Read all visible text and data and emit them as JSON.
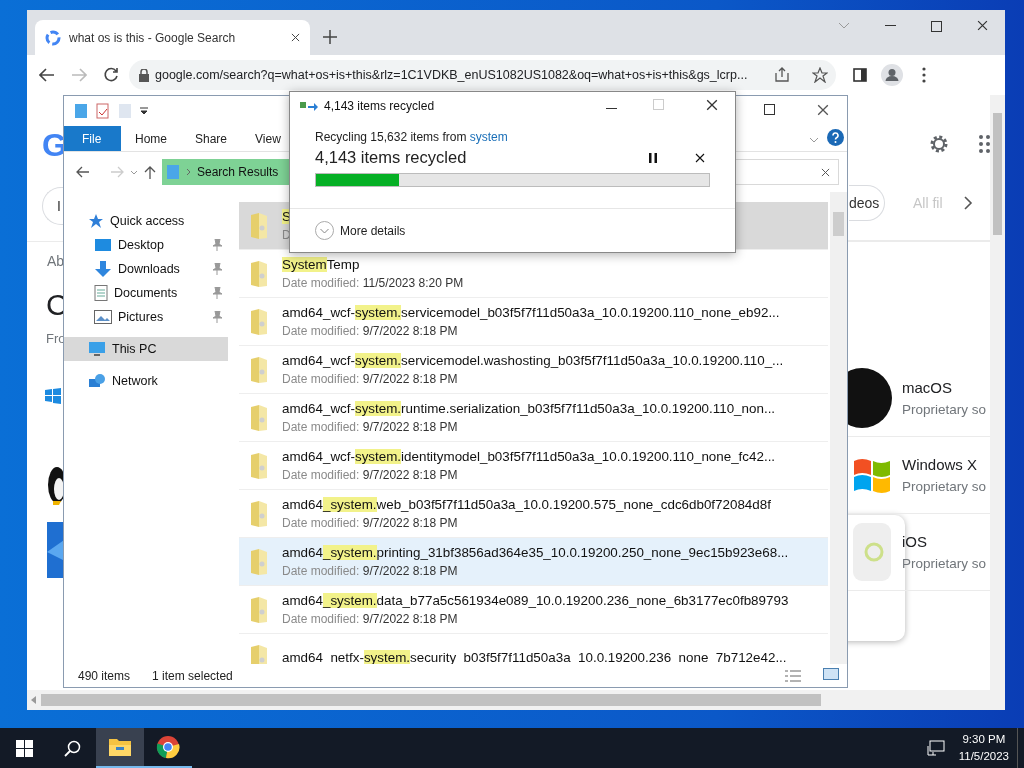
{
  "browser": {
    "tab": {
      "title": "what os is this - Google Search",
      "selected": true
    },
    "url": "google.com/search?q=what+os+is+this&rlz=1C1VDKB_enUS1082US1082&oq=what+os+is+this&gs_lcrp...",
    "page": {
      "logo_fragment": "G",
      "left_chip": "I",
      "about_fragment": "Ab",
      "heading_fragment": "C",
      "source_fragment": "Fro",
      "chips": [
        {
          "label": "deos",
          "faded": false
        },
        {
          "label": "All fil",
          "faded": true
        }
      ],
      "results": [
        {
          "kind": "mac",
          "title": "macOS",
          "subtitle": "Proprietary so"
        },
        {
          "kind": "windows",
          "title": "Windows X",
          "subtitle": "Proprietary so"
        },
        {
          "kind": "ios",
          "title": "iOS",
          "subtitle": "Proprietary so"
        }
      ]
    }
  },
  "explorer": {
    "ribbon_tabs": [
      {
        "label": "File",
        "kind": "backstage"
      },
      {
        "label": "Home",
        "kind": "tab"
      },
      {
        "label": "Share",
        "kind": "tab"
      },
      {
        "label": "View",
        "kind": "tab"
      }
    ],
    "breadcrumb": "Search Results",
    "nav": [
      {
        "label": "Quick access",
        "kind": "star",
        "pinned": false,
        "selected": false,
        "children": [
          {
            "label": "Desktop",
            "kind": "desktop",
            "pinned": true,
            "selected": false
          },
          {
            "label": "Downloads",
            "kind": "downloads",
            "pinned": true,
            "selected": false
          },
          {
            "label": "Documents",
            "kind": "documents",
            "pinned": true,
            "selected": false
          },
          {
            "label": "Pictures",
            "kind": "pictures",
            "pinned": true,
            "selected": false
          }
        ]
      },
      {
        "label": "This PC",
        "kind": "pc",
        "pinned": false,
        "selected": true
      },
      {
        "label": "Network",
        "kind": "network",
        "pinned": false,
        "selected": false
      }
    ],
    "files": [
      {
        "segments": [
          {
            "text": "S",
            "highlight": true
          }
        ],
        "date_label": "D",
        "selected": true,
        "hovered": false
      },
      {
        "segments": [
          {
            "text": "System",
            "highlight": true
          },
          {
            "text": "Temp",
            "highlight": false
          }
        ],
        "date_label": "Date modified:",
        "date": "11/5/2023 8:20 PM",
        "selected": false,
        "hovered": false
      },
      {
        "segments": [
          {
            "text": "amd64_wcf-",
            "highlight": false
          },
          {
            "text": "system.",
            "highlight": true
          },
          {
            "text": "servicemodel_b03f5f7f11d50a3a_10.0.19200.110_none_eb92...",
            "highlight": false
          }
        ],
        "date_label": "Date modified:",
        "date": "9/7/2022 8:18 PM",
        "selected": false,
        "hovered": false
      },
      {
        "segments": [
          {
            "text": "amd64_wcf-",
            "highlight": false
          },
          {
            "text": "system.",
            "highlight": true
          },
          {
            "text": "servicemodel.washosting_b03f5f7f11d50a3a_10.0.19200.110_...",
            "highlight": false
          }
        ],
        "date_label": "Date modified:",
        "date": "9/7/2022 8:18 PM",
        "selected": false,
        "hovered": false
      },
      {
        "segments": [
          {
            "text": "amd64_wcf-",
            "highlight": false
          },
          {
            "text": "system.",
            "highlight": true
          },
          {
            "text": "runtime.serialization_b03f5f7f11d50a3a_10.0.19200.110_non...",
            "highlight": false
          }
        ],
        "date_label": "Date modified:",
        "date": "9/7/2022 8:18 PM",
        "selected": false,
        "hovered": false
      },
      {
        "segments": [
          {
            "text": "amd64_wcf-",
            "highlight": false
          },
          {
            "text": "system.",
            "highlight": true
          },
          {
            "text": "identitymodel_b03f5f7f11d50a3a_10.0.19200.110_none_fc42...",
            "highlight": false
          }
        ],
        "date_label": "Date modified:",
        "date": "9/7/2022 8:18 PM",
        "selected": false,
        "hovered": false
      },
      {
        "segments": [
          {
            "text": "amd64",
            "highlight": false
          },
          {
            "text": "_system.",
            "highlight": true
          },
          {
            "text": "web_b03f5f7f11d50a3a_10.0.19200.575_none_cdc6db0f72084d8f",
            "highlight": false
          }
        ],
        "date_label": "Date modified:",
        "date": "9/7/2022 8:18 PM",
        "selected": false,
        "hovered": false
      },
      {
        "segments": [
          {
            "text": "amd64",
            "highlight": false
          },
          {
            "text": "_system.",
            "highlight": true
          },
          {
            "text": "printing_31bf3856ad364e35_10.0.19200.250_none_9ec15b923e68...",
            "highlight": false
          }
        ],
        "date_label": "Date modified:",
        "date": "9/7/2022 8:18 PM",
        "selected": false,
        "hovered": true
      },
      {
        "segments": [
          {
            "text": "amd64",
            "highlight": false
          },
          {
            "text": "_system.",
            "highlight": true
          },
          {
            "text": "data_b77a5c561934e089_10.0.19200.236_none_6b3177ec0fb89793",
            "highlight": false
          }
        ],
        "date_label": "Date modified:",
        "date": "9/7/2022 8:18 PM",
        "selected": false,
        "hovered": false
      },
      {
        "segments": [
          {
            "text": "amd64_netfx-",
            "highlight": false
          },
          {
            "text": "system.",
            "highlight": true
          },
          {
            "text": "security_b03f5f7f11d50a3a_10.0.19200.236_none_7b712e42...",
            "highlight": false
          }
        ],
        "selected": false,
        "hovered": false
      }
    ],
    "status": {
      "count": "490 items",
      "selection": "1 item selected"
    }
  },
  "dialog": {
    "title": "4,143 items recycled",
    "source_text": "Recycling 15,632 items from",
    "source_link": "system",
    "progress_text": "4,143 items recycled",
    "level": 0.21,
    "details_label": "More details"
  },
  "taskbar": {
    "apps": [
      {
        "kind": "explorer",
        "active": true
      },
      {
        "kind": "chrome",
        "active": false
      }
    ],
    "time": "9:30 PM",
    "date": "11/5/2023"
  }
}
